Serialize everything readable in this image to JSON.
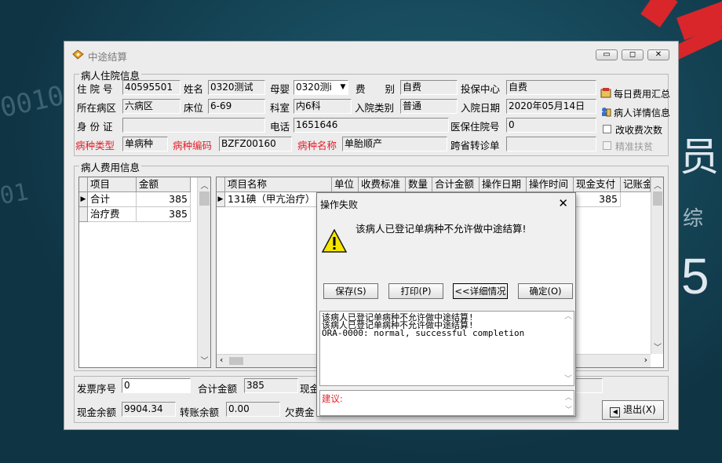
{
  "window": {
    "title": "中途结算"
  },
  "patient": {
    "group_title": "病人住院信息",
    "admission_no_label": "住 院 号",
    "admission_no": "40595501",
    "name_label": "姓名",
    "name": "0320测试",
    "mother_baby_label": "母婴",
    "mother_baby": "0320测i",
    "fee_type_label": "费　　别",
    "fee_type": "自费",
    "insurance_center_label": "投保中心",
    "insurance_center": "自费",
    "ward_label": "所在病区",
    "ward": "六病区",
    "bed_label": "床位",
    "bed": "6-69",
    "dept_label": "科室",
    "dept": "内6科",
    "admission_type_label": "入院类别",
    "admission_type": "普通",
    "admission_date_label": "入院日期",
    "admission_date": "2020年05月14日",
    "id_card_label": "身 份 证",
    "id_card": "",
    "phone_label": "电话",
    "phone": "1651646",
    "insurance_no_label": "医保住院号",
    "insurance_no": "0",
    "disease_type_label": "病种类型",
    "disease_type": "单病种",
    "disease_code_label": "病种编码",
    "disease_code": "BZFZ00160",
    "disease_name_label": "病种名称",
    "disease_name": "单胎顺产",
    "cross_province_label": "跨省转诊单",
    "cross_province": ""
  },
  "side": {
    "daily_summary": "每日费用汇总",
    "patient_detail": "病人详情信息",
    "change_count": "改收费次数",
    "precise_poverty": "精准扶贫"
  },
  "fees": {
    "group_title": "病人费用信息",
    "left_headers": [
      "项目",
      "金额"
    ],
    "left_rows": [
      {
        "item": "合计",
        "amount": "385"
      },
      {
        "item": "治疗费",
        "amount": "385"
      }
    ],
    "right_headers": [
      "项目名称",
      "单位",
      "收费标准",
      "数量",
      "合计金额",
      "操作日期",
      "操作时间",
      "现金支付",
      "记账金"
    ],
    "right_rows": [
      {
        "name": "131碘（甲亢治疗）",
        "cash": "385"
      }
    ]
  },
  "bottom": {
    "invoice_no_label": "发票序号",
    "invoice_no": "0",
    "total_label": "合计金额",
    "total": "385",
    "cash_label": "现金",
    "cash_balance_label": "现金余额",
    "cash_balance": "9904.34",
    "transfer_balance_label": "转账余额",
    "transfer_balance": "0.00",
    "arrears_label": "欠费金",
    "exit_button": "退出(X)"
  },
  "dialog": {
    "title": "操作失败",
    "message": "该病人已登记单病种不允许做中途结算!",
    "buttons": {
      "save": "保存(S)",
      "print": "打印(P)",
      "details": "<<详细情况",
      "ok": "确定(O)"
    },
    "detail_lines": [
      "该病人已登记单病种不允许做中途结算!",
      "该病人已登记单病种不允许做中途结算!",
      "ORA-0000: normal, successful completion"
    ],
    "advice_label": "建议:"
  },
  "colors": {
    "desktop": "#0f3444",
    "accent_red": "#e3202b",
    "window_bg": "#ececec"
  }
}
